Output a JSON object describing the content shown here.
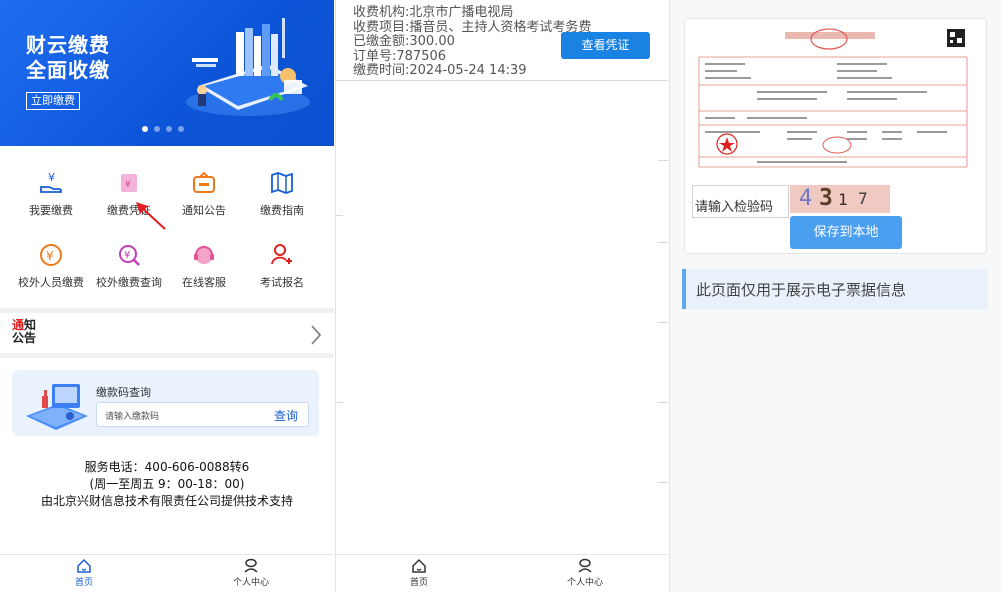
{
  "panel_home": {
    "banner": {
      "title_line1": "财云缴费",
      "title_line2": "全面收缴",
      "cta": "立即缴费",
      "slides": 4,
      "active_slide": 1
    },
    "grid": [
      {
        "label": "我要缴费",
        "icon": "yen-hand-icon"
      },
      {
        "label": "缴费凭证",
        "icon": "receipt-icon"
      },
      {
        "label": "通知公告",
        "icon": "notice-box-icon"
      },
      {
        "label": "缴费指南",
        "icon": "map-guide-icon"
      },
      {
        "label": "校外人员缴费",
        "icon": "yen-circle-icon"
      },
      {
        "label": "校外缴费查询",
        "icon": "yen-search-icon"
      },
      {
        "label": "在线客服",
        "icon": "headset-icon"
      },
      {
        "label": "考试报名",
        "icon": "user-add-icon"
      }
    ],
    "notice": {
      "tag_top_red": "通",
      "tag_top": "知",
      "tag_bottom": "公告"
    },
    "query": {
      "title": "缴款码查询",
      "placeholder": "请输入缴款码",
      "button": "查询"
    },
    "service": {
      "phone": "服务电话：400-606-0088转6",
      "hours": "(周一至周五 9：00-18：00)",
      "support": "由北京兴财信息技术有限责任公司提供技术支持"
    },
    "tabs": [
      {
        "label": "首页",
        "icon": "home-icon",
        "active": true
      },
      {
        "label": "个人中心",
        "icon": "user-center-icon",
        "active": false
      }
    ]
  },
  "panel_order": {
    "lines": [
      "收费机构:北京市广播电视局",
      "收费项目:播音员、主持人资格考试考务费",
      "已缴金额:300.00",
      "订单号:787506",
      "缴费时间:2024-05-24 14:39"
    ],
    "view_button": "查看凭证",
    "tabs": [
      {
        "label": "首页",
        "icon": "home-icon"
      },
      {
        "label": "个人中心",
        "icon": "user-center-icon"
      }
    ]
  },
  "panel_ticket": {
    "captcha_placeholder": "请输入检验码",
    "captcha_chars": [
      "4",
      "3",
      "1",
      "7"
    ],
    "save_button": "保存到本地",
    "info": "此页面仅用于展示电子票据信息"
  },
  "colors": {
    "primary": "#1a5fd6",
    "banner": "#0d55d8",
    "button_blue": "#1a82e2",
    "save_blue": "#4a9ff0",
    "accent_red": "#e02020"
  }
}
